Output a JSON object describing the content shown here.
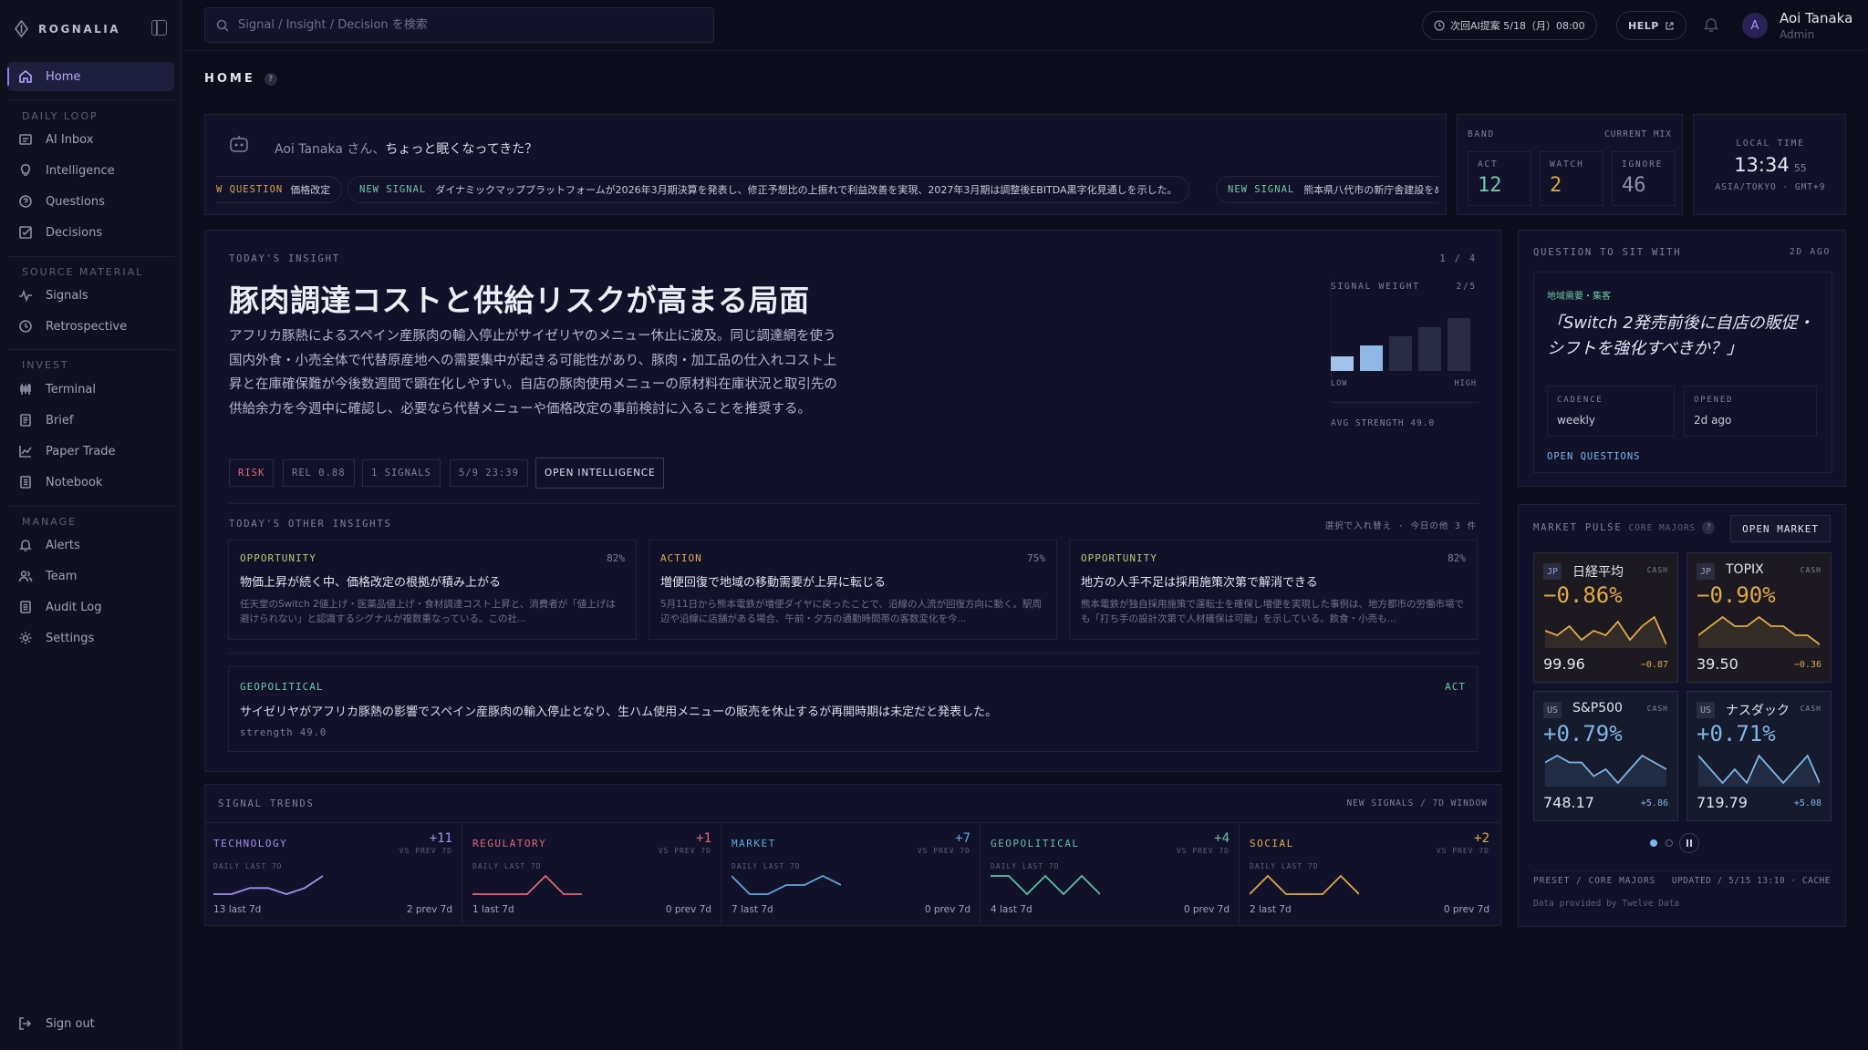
{
  "app": {
    "name": "ROGNALIA"
  },
  "sidebar": {
    "home": "Home",
    "sections": {
      "daily": "DAILY LOOP",
      "source": "SOURCE MATERIAL",
      "invest": "INVEST",
      "manage": "MANAGE"
    },
    "daily": [
      "AI Inbox",
      "Intelligence",
      "Questions",
      "Decisions"
    ],
    "source": [
      "Signals",
      "Retrospective"
    ],
    "invest": [
      "Terminal",
      "Brief",
      "Paper Trade",
      "Notebook"
    ],
    "manage": [
      "Alerts",
      "Team",
      "Audit Log",
      "Settings"
    ],
    "signout": "Sign out"
  },
  "topbar": {
    "search_placeholder": "Signal / Insight / Decision を検索",
    "next_proposal": "次回AI提案 5/18（月）08:00",
    "help": "HELP",
    "user_name": "Aoi Tanaka",
    "user_role": "Admin",
    "avatar_initial": "A"
  },
  "page": {
    "title": "HOME",
    "help_mark": "?"
  },
  "greeting": {
    "name_part": "Aoi Tanaka さん、",
    "message": "ちょっと眠くなってきた？"
  },
  "ticker": [
    {
      "kind": "W QUESTION",
      "text": "価格改定"
    },
    {
      "kind": "NEW SIGNAL",
      "text": "ダイナミックマッププラットフォームが2026年3月期決算を発表し、修正予想比の上振れで利益改善を実現、2027年3月期は調整後EBITDA黒字化見通しを示した。"
    },
    {
      "kind": "NEW SIGNAL",
      "text": "熊本県八代市の新庁舎建設をめ‹"
    }
  ],
  "band": {
    "label": "BAND",
    "mix": "CURRENT MIX",
    "items": [
      {
        "label": "ACT",
        "value": "12",
        "color": "#6fc7a4"
      },
      {
        "label": "WATCH",
        "value": "2",
        "color": "#d9a63f"
      },
      {
        "label": "IGNORE",
        "value": "46",
        "color": "#8e92a8"
      }
    ]
  },
  "clock": {
    "label": "LOCAL TIME",
    "time": "13:34",
    "sec": "55",
    "zone": "ASIA/TOKYO · GMT+9"
  },
  "insight": {
    "label": "TODAY'S INSIGHT",
    "page": "1 / 4",
    "title": "豚肉調達コストと供給リスクが高まる局面",
    "body": "アフリカ豚熱によるスペイン産豚肉の輸入停止がサイゼリヤのメニュー休止に波及。同じ調達網を使う国内外食・小売全体で代替原産地への需要集中が起きる可能性があり、豚肉・加工品の仕入れコスト上昇と在庫確保難が今後数週間で顕在化しやすい。自店の豚肉使用メニューの原材料在庫状況と取引先の供給余力を今週中に確認し、必要なら代替メニューや価格改定の事前検討に入ることを推奨する。",
    "tags": {
      "risk": "RISK",
      "rel": "REL 0.88",
      "signals": "1 SIGNALS",
      "date": "5/9 23:39"
    },
    "open": "OPEN INTELLIGENCE",
    "weight": {
      "label": "SIGNAL WEIGHT",
      "score": "2/5",
      "level": 2,
      "low": "LOW",
      "high": "HIGH",
      "avg": "AVG STRENGTH 49.0"
    }
  },
  "others": {
    "label": "TODAY'S OTHER INSIGHTS",
    "hint": "選択で入れ替え · 今日の他 3 件",
    "cards": [
      {
        "kind": "OPPORTUNITY",
        "color": "#b9c86a",
        "pct": "82%",
        "title": "物価上昇が続く中、価格改定の根拠が積み上がる",
        "body": "任天堂のSwitch 2値上げ・医薬品値上げ・食材調達コスト上昇と、消費者が「値上げは避けられない」と認識するシグナルが複数重なっている。この社..."
      },
      {
        "kind": "ACTION",
        "color": "#e0a94a",
        "pct": "75%",
        "title": "増便回復で地域の移動需要が上昇に転じる",
        "body": "5月11日から熊本電鉄が増便ダイヤに戻ったことで、沿線の人流が回復方向に動く。駅周辺や沿線に店舗がある場合、午前・夕方の通勤時間帯の客数変化を今..."
      },
      {
        "kind": "OPPORTUNITY",
        "color": "#b9c86a",
        "pct": "82%",
        "title": "地方の人手不足は採用施策次第で解消できる",
        "body": "熊本電鉄が独自採用施策で運転士を確保し増便を実現した事例は、地方都市の労働市場でも「打ち手の設計次第で人材確保は可能」を示している。飲食・小売も..."
      }
    ],
    "geo": {
      "kind": "GEOPOLITICAL",
      "band": "ACT",
      "text": "サイゼリヤがアフリカ豚熱の影響でスペイン産豚肉の輸入停止となり、生ハム使用メニューの販売を休止するが再開時期は未定だと発表した。",
      "strength": "strength 49.0"
    }
  },
  "trends": {
    "label": "SIGNAL TRENDS",
    "window": "NEW SIGNALS / 7D WINDOW",
    "vs": "VS PREV 7D",
    "daily": "DAILY LAST 7D",
    "items": [
      {
        "name": "TECHNOLOGY",
        "delta": "+11",
        "last": "13 last 7d",
        "prev": "2 prev 7d",
        "color": "#a48ef0",
        "values": [
          1,
          1,
          2,
          2,
          1,
          2,
          4
        ]
      },
      {
        "name": "REGULATORY",
        "delta": "+1",
        "last": "1 last 7d",
        "prev": "0 prev 7d",
        "color": "#e0697a",
        "values": [
          0,
          0,
          0,
          0,
          1,
          0,
          0
        ]
      },
      {
        "name": "MARKET",
        "delta": "+7",
        "last": "7 last 7d",
        "prev": "0 prev 7d",
        "color": "#5fa8e0",
        "values": [
          2,
          0,
          0,
          1,
          1,
          2,
          1
        ]
      },
      {
        "name": "GEOPOLITICAL",
        "delta": "+4",
        "last": "4 last 7d",
        "prev": "0 prev 7d",
        "color": "#5ec2a0",
        "values": [
          1,
          1,
          0,
          1,
          0,
          1,
          0
        ]
      },
      {
        "name": "SOCIAL",
        "delta": "+2",
        "last": "2 last 7d",
        "prev": "0 prev 7d",
        "color": "#e0a94a",
        "values": [
          0,
          1,
          0,
          0,
          0,
          1,
          0
        ]
      }
    ]
  },
  "question": {
    "label": "QUESTION TO SIT WITH",
    "ago": "2D AGO",
    "category": "地域需要・集客",
    "text": "「Switch 2発売前後に自店の販促・シフトを強化すべきか？」",
    "cadence_label": "CADENCE",
    "cadence": "weekly",
    "opened_label": "OPENED",
    "opened": "2d ago",
    "open": "OPEN QUESTIONS"
  },
  "market": {
    "label": "MARKET PULSE",
    "sub": "CORE MAJORS",
    "open": "OPEN MARKET",
    "cash": "CASH",
    "cards": [
      {
        "region": "JP",
        "name": "日経平均",
        "pct": "−0.86%",
        "value": "99.96",
        "chg": "−0.87",
        "trend": "down",
        "values": [
          5,
          4,
          6,
          3,
          5,
          4,
          7,
          3,
          6,
          8,
          2
        ]
      },
      {
        "region": "JP",
        "name": "TOPIX",
        "pct": "−0.90%",
        "value": "39.50",
        "chg": "−0.36",
        "trend": "down",
        "values": [
          5,
          6,
          7,
          6,
          6,
          7,
          6,
          6,
          5,
          5,
          4
        ]
      },
      {
        "region": "US",
        "name": "S&P500",
        "pct": "+0.79%",
        "value": "748.17",
        "chg": "+5.86",
        "trend": "up",
        "values": [
          5,
          6,
          5,
          5,
          3,
          4,
          2,
          4,
          6,
          5,
          4
        ]
      },
      {
        "region": "US",
        "name": "ナスダック",
        "pct": "+0.71%",
        "value": "719.79",
        "chg": "+5.08",
        "trend": "up",
        "values": [
          6,
          5,
          4,
          5,
          4,
          6,
          5,
          4,
          5,
          6,
          4
        ]
      }
    ],
    "preset": "PRESET / CORE MAJORS",
    "updated": "UPDATED / 5/15 13:10 · CACHE",
    "provider": "Data provided by Twelve Data",
    "colors": {
      "down": "#e0a94a",
      "up": "#7fb6e8"
    }
  }
}
